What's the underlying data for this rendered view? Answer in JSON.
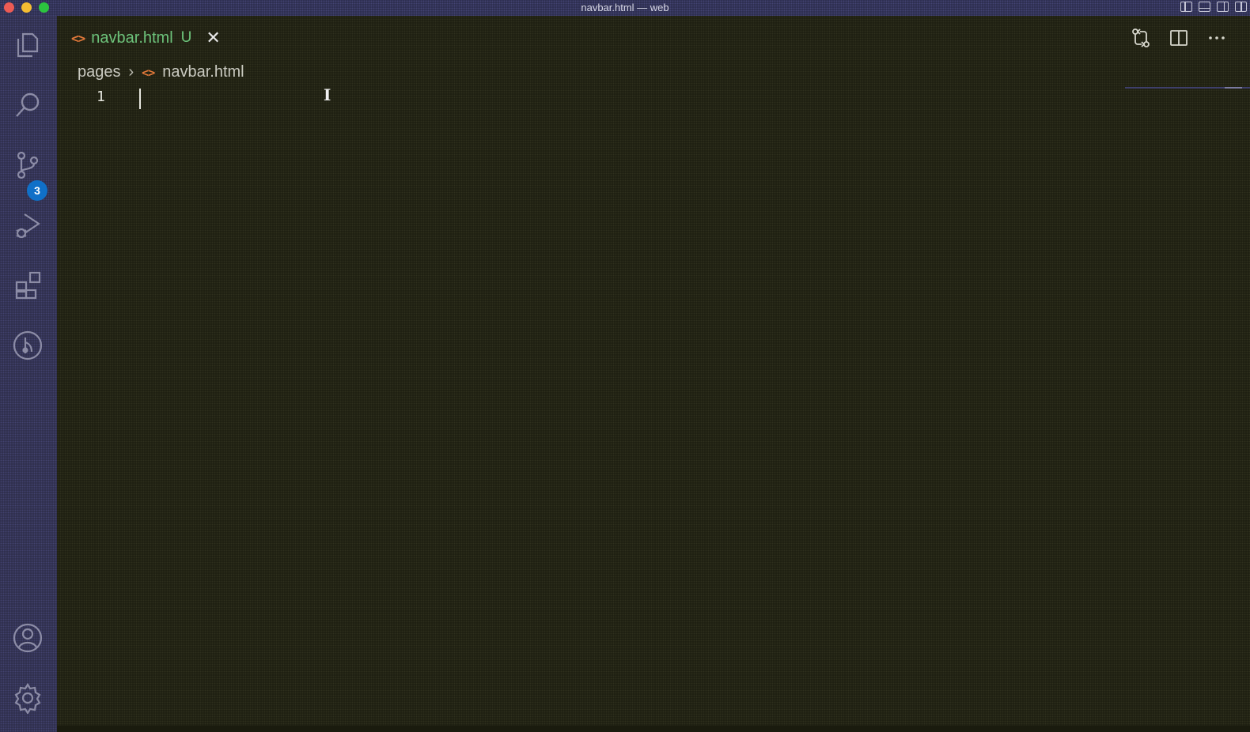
{
  "window": {
    "title": "navbar.html — web"
  },
  "activity_bar": {
    "items": [
      {
        "name": "explorer",
        "icon": "files-icon"
      },
      {
        "name": "search",
        "icon": "search-icon"
      },
      {
        "name": "source-control",
        "icon": "source-control-icon",
        "badge": "3"
      },
      {
        "name": "run-and-debug",
        "icon": "run-debug-icon"
      },
      {
        "name": "extensions",
        "icon": "extensions-icon"
      },
      {
        "name": "git-graph",
        "icon": "git-graph-icon"
      }
    ],
    "bottom_items": [
      {
        "name": "accounts",
        "icon": "account-icon"
      },
      {
        "name": "manage",
        "icon": "gear-icon"
      }
    ]
  },
  "editor": {
    "tab": {
      "label": "navbar.html",
      "status": "U",
      "icon": "html-file-icon"
    },
    "toolbar": {
      "icons": [
        "compare-changes-icon",
        "split-editor-icon",
        "more-actions-icon"
      ]
    },
    "breadcrumb": {
      "folder": "pages",
      "file": "navbar.html"
    },
    "lines": [
      {
        "number": "1",
        "text": ""
      }
    ]
  },
  "colors": {
    "activity_bar_bg": "#2c2c48",
    "editor_bg": "#1c1d10",
    "tab_modified_text": "#6cc27a",
    "html_icon": "#e2793a",
    "badge_bg": "#1070c8"
  }
}
